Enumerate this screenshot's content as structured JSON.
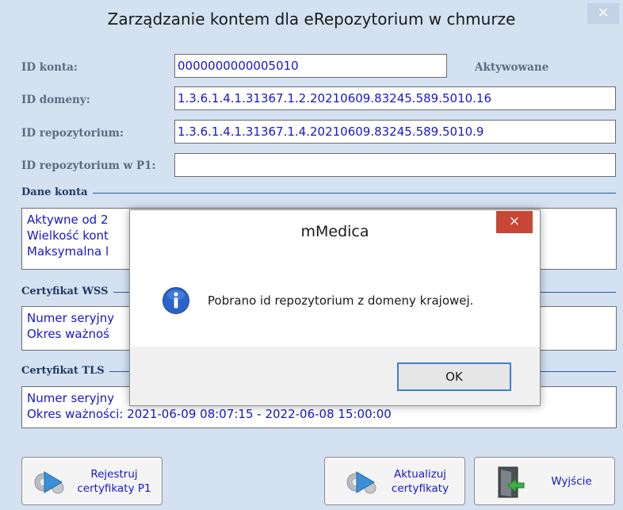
{
  "window": {
    "title": "Zarządzanie kontem dla eRepozytorium w chmurze",
    "close_glyph": "×"
  },
  "fields": {
    "account_id_label": "ID konta:",
    "account_id_value": "0000000000005010",
    "status": "Aktywowane",
    "domain_id_label": "ID domeny:",
    "domain_id_value": "1.3.6.1.4.1.31367.1.2.20210609.83245.589.5010.16",
    "repo_id_label": "ID repozytorium:",
    "repo_id_value": "1.3.6.1.4.1.31367.1.4.20210609.83245.589.5010.9",
    "repo_p1_label": "ID repozytorium w P1:",
    "repo_p1_value": ""
  },
  "account_data": {
    "title": "Dane konta",
    "lines": [
      "Aktywne od 2",
      "Wielkość kont",
      "Maksymalna l"
    ]
  },
  "wss_cert": {
    "title": "Certyfikat WSS",
    "lines": [
      "Numer seryjny",
      "Okres ważnoś"
    ]
  },
  "tls_cert": {
    "title": "Certyfikat TLS",
    "lines": [
      "Numer seryjny",
      "Okres ważności: 2021-06-09 08:07:15 - 2022-06-08 15:00:00"
    ]
  },
  "buttons": {
    "register_p1": [
      "Rejestruj",
      "certyfikaty P1"
    ],
    "update_certs": [
      "Aktualizuj",
      "certyfikaty"
    ],
    "exit": "Wyjście"
  },
  "dialog": {
    "title": "mMedica",
    "close_glyph": "×",
    "message": "Pobrano id repozytorium z domeny krajowej.",
    "ok_label": "OK",
    "icon": "info-icon"
  },
  "colors": {
    "window_bg": "#d3e1f1",
    "text_blue": "#1717c8",
    "dialog_close": "#c84734"
  }
}
